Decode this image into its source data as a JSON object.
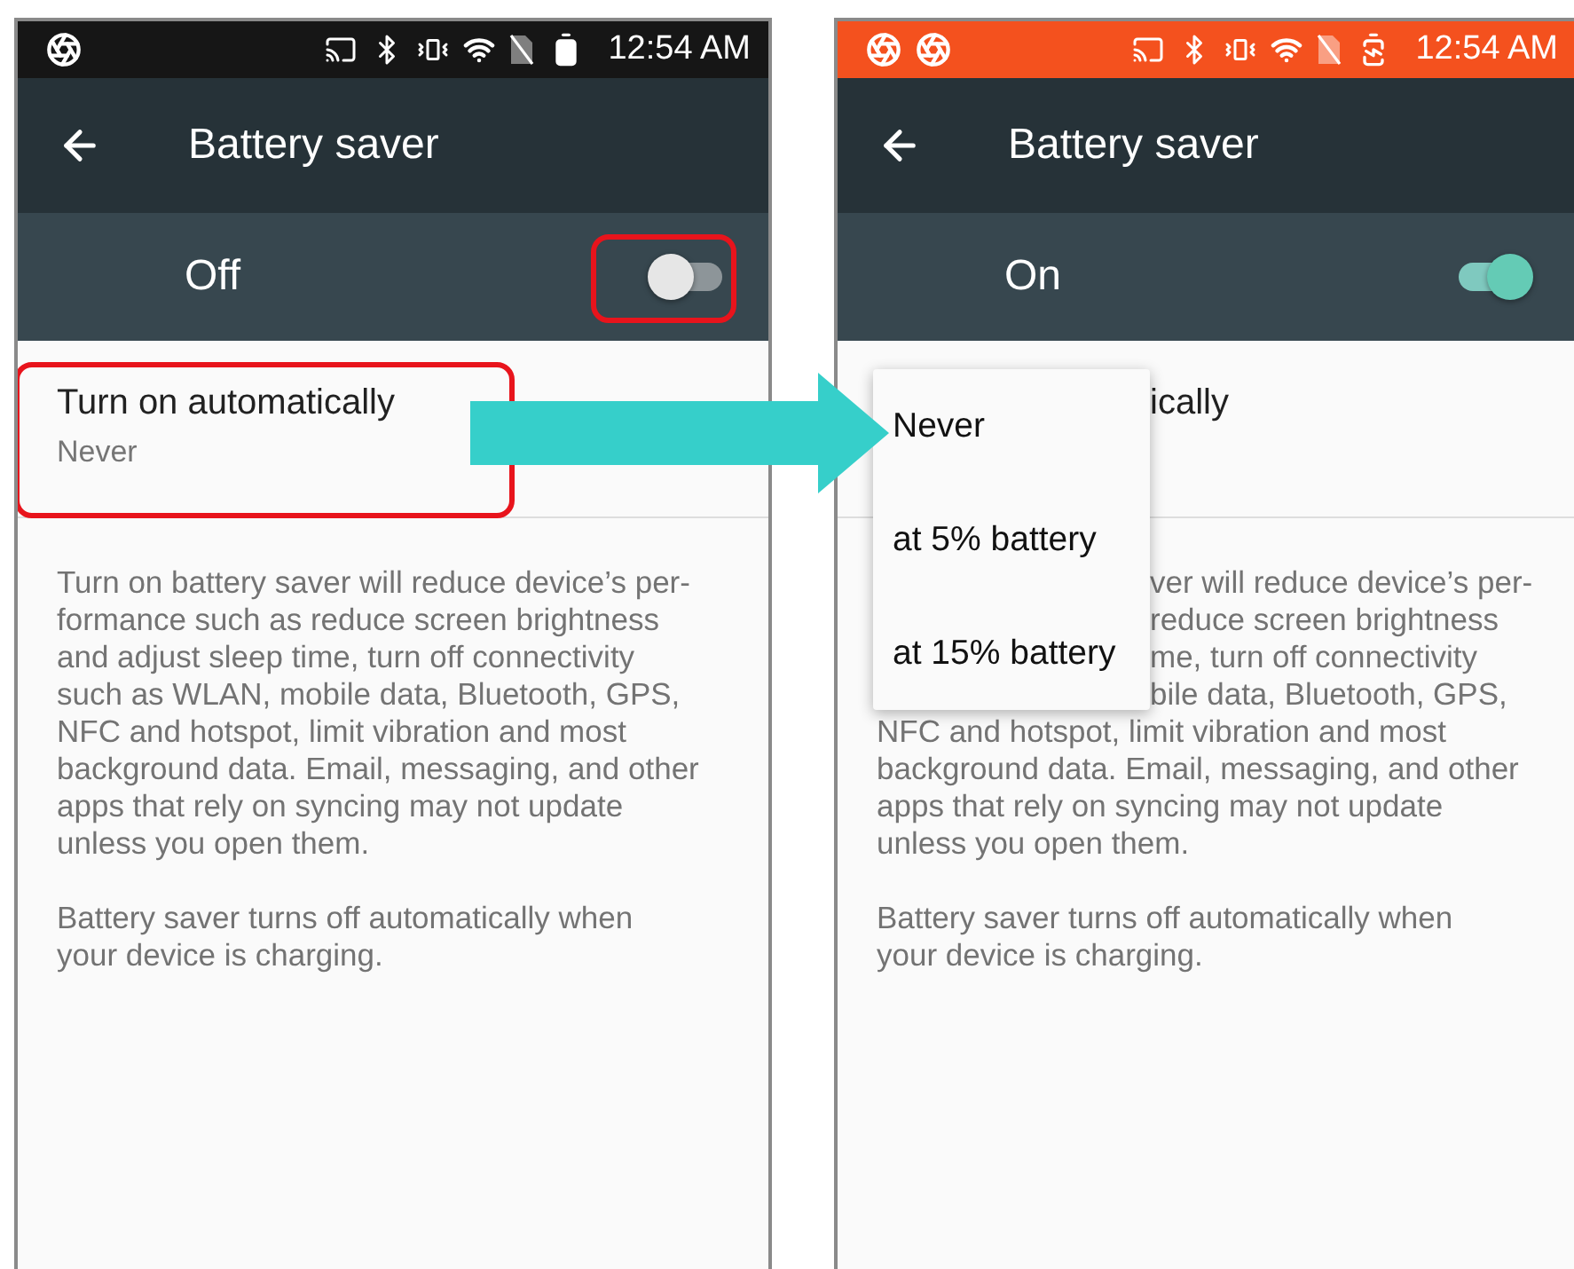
{
  "panels": [
    {
      "status_bar": {
        "notifications": [
          {
            "kind": "aperture"
          }
        ],
        "battery_charging": false,
        "time": "12:54 AM"
      },
      "title": "Battery saver",
      "master": {
        "label": "Off",
        "on": false
      },
      "highlight_toggle": true,
      "highlight_auto": true,
      "auto": {
        "title": "Turn on automatically",
        "summary": "Never"
      },
      "description": [
        {
          "lines": [
            {
              "text": "Turn on battery saver will reduce device’s per-",
              "kind": "plain"
            },
            {
              "text": "formance such as reduce screen brightness",
              "kind": "plain"
            },
            {
              "text": "and adjust sleep time, turn off connectivity",
              "kind": "plain"
            },
            {
              "text": "such as WLAN, mobile data, Bluetooth, GPS,",
              "kind": "plain"
            },
            {
              "text": "NFC and hotspot, limit vibration and most",
              "kind": "plain"
            },
            {
              "text": "background data. Email, messaging, and other",
              "kind": "plain"
            },
            {
              "text": "apps that rely on syncing may not update",
              "kind": "plain"
            },
            {
              "text": "unless you open them.",
              "kind": "plain"
            }
          ]
        },
        {
          "lines": [
            {
              "text": "Battery saver turns off automatically when",
              "kind": "plain"
            },
            {
              "text": "your device is charging.",
              "kind": "plain"
            }
          ]
        }
      ]
    },
    {
      "status_bar": {
        "notifications": [
          {
            "kind": "aperture"
          },
          {
            "kind": "aperture"
          }
        ],
        "battery_charging": true,
        "time": "12:54 AM"
      },
      "title": "Battery saver",
      "master": {
        "label": "On",
        "on": true
      },
      "auto": {
        "title": "ically"
      },
      "menu": [
        {
          "label": "Never"
        },
        {
          "label": "at 5% battery"
        },
        {
          "label": "at 15% battery"
        }
      ],
      "description": [
        {
          "lines": [
            {
              "text": "ver will reduce device’s per-",
              "kind": "covered"
            },
            {
              "text": "reduce screen brightness",
              "kind": "covered"
            },
            {
              "text": "me, turn off connectivity",
              "kind": "covered"
            },
            {
              "text": "bile data, Bluetooth, GPS,",
              "kind": "covered"
            },
            {
              "text": "NFC and hotspot, limit vibration and most",
              "kind": "plain"
            },
            {
              "text": "background data. Email, messaging, and other",
              "kind": "plain"
            },
            {
              "text": "apps that rely on syncing may not update",
              "kind": "plain"
            },
            {
              "text": "unless you open them.",
              "kind": "plain"
            }
          ]
        },
        {
          "lines": [
            {
              "text": "Battery saver turns off automatically when",
              "kind": "plain"
            },
            {
              "text": "your device is charging.",
              "kind": "plain"
            }
          ]
        }
      ]
    }
  ]
}
